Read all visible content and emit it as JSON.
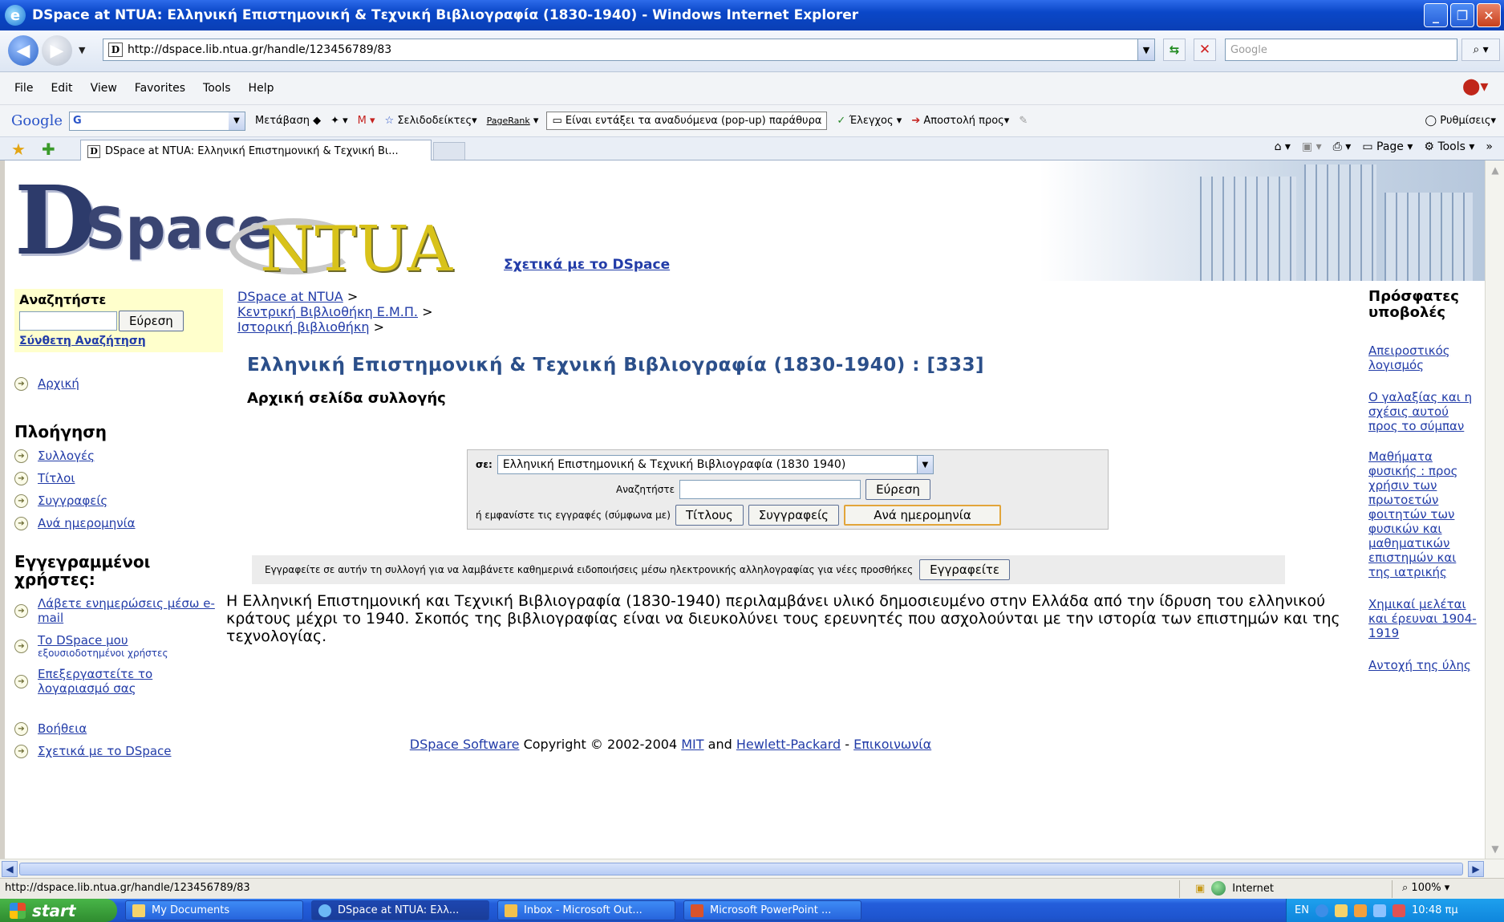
{
  "window": {
    "title": "DSpace at NTUA: Ελληνική Επιστημονική & Τεχνική Βιβλιογραφία (1830-1940) - Windows Internet Explorer",
    "buttons": [
      "_",
      "❐",
      "✕"
    ]
  },
  "address_bar": {
    "url": "http://dspace.lib.ntua.gr/handle/123456789/83",
    "search_placeholder": "Google"
  },
  "menu": [
    "File",
    "Edit",
    "View",
    "Favorites",
    "Tools",
    "Help"
  ],
  "google_toolbar": {
    "logo": "Google",
    "search_value": "G",
    "go": "Μετάβαση",
    "bookmarks": "Σελιδοδείκτες",
    "pagerank": "PageRank",
    "popups": "Είναι εντάξει τα αναδυόμενα (pop-up) παράθυρα",
    "check": "Έλεγχος",
    "send_to": "Αποστολή προς",
    "settings": "Ρυθμίσεις"
  },
  "tabs": {
    "active_title": "DSpace at NTUA: Ελληνική Επιστημονική & Τεχνική Βι...",
    "page": "Page",
    "tools": "Tools"
  },
  "page": {
    "logo": {
      "d": "D",
      "space": "Space",
      "ntua": "NTUA"
    },
    "about_link": "Σχετικά με το DSpace",
    "left": {
      "search_label": "Αναζητήστε",
      "search_button": "Εύρεση",
      "advanced_search": "Σύνθετη Αναζήτηση",
      "home": "Αρχική",
      "browse_heading": "Πλοήγηση",
      "browse_items": [
        "Συλλογές",
        "Τίτλοι",
        "Συγγραφείς",
        "Ανά ημερομηνία"
      ],
      "users_heading": "Εγγεγραμμένοι χρήστες:",
      "user_items": [
        {
          "label": "Λάβετε ενημερώσεις μέσω e-mail",
          "sub": ""
        },
        {
          "label": "Το DSpace μου",
          "sub": "εξουσιοδοτημένοι χρήστες"
        },
        {
          "label": "Επεξεργαστείτε το λογαριασμό σας",
          "sub": ""
        }
      ],
      "help": "Βοήθεια",
      "about": "Σχετικά με το DSpace"
    },
    "breadcrumb": [
      "DSpace at NTUA",
      "Κεντρική Βιβλιοθήκη Ε.Μ.Π.",
      "Ιστορική βιβλιοθήκη"
    ],
    "breadcrumb_sep": ">",
    "collection_title": "Ελληνική Επιστημονική & Τεχνική Βιβλιογραφία (1830-1940) : [333]",
    "collection_subtitle": "Αρχική σελίδα συλλογής",
    "search_panel": {
      "in_label": "σε:",
      "scope": "Ελληνική Επιστημονική & Τεχνική Βιβλιογραφία (1830 1940)",
      "search_label": "Αναζητήστε",
      "find_button": "Εύρεση",
      "browse_label": "ή εμφανίστε τις εγγραφές (σύμφωνα με)",
      "browse_buttons": [
        "Τίτλους",
        "Συγγραφείς",
        "Ανά ημερομηνία"
      ]
    },
    "subscribe": {
      "text": "Εγγραφείτε σε αυτήν τη συλλογή για να λαμβάνετε καθημερινά ειδοποιήσεις μέσω ηλεκτρονικής αλληλογραφίας για νέες προσθήκες",
      "button": "Εγγραφείτε"
    },
    "description": "Η Ελληνική Επιστημονική και Τεχνική Βιβλιογραφία (1830-1940) περιλαμβάνει υλικό δημοσιευμένο στην Ελλάδα από την ίδρυση του ελληνικού κράτους μέχρι το 1940. Σκοπός της βιβλιογραφίας είναι να διευκολύνει τους ερευνητές που ασχολούνται με την ιστορία των επιστημών και της τεχνολογίας.",
    "footer": {
      "software": "DSpace Software",
      "copyright": "Copyright © 2002-2004",
      "mit": "MIT",
      "and": "and",
      "hp": "Hewlett-Packard",
      "dash": "-",
      "contact": "Επικοινωνία"
    },
    "right": {
      "heading": "Πρόσφατες υποβολές",
      "items": [
        "Απειροστικός λογισμός",
        "Ο γαλαξίας και η σχέσις αυτού προς το σύμπαν",
        "Μαθήματα φυσικής : προς χρήσιν των πρωτοετών φοιτητών των φυσικών και μαθηματικών επιστημών και της ιατρικής",
        "Χημικαί μελέται και έρευναι 1904-1919",
        "Αντοχή της ύλης"
      ]
    }
  },
  "status_bar": {
    "url": "http://dspace.lib.ntua.gr/handle/123456789/83",
    "zone": "Internet",
    "zoom": "100%"
  },
  "taskbar": {
    "start": "start",
    "tasks": [
      "My Documents",
      "DSpace at NTUA: Ελλ...",
      "Inbox - Microsoft Out...",
      "Microsoft PowerPoint ..."
    ],
    "lang": "EN",
    "clock": "10:48 πμ"
  },
  "colors": {
    "link": "#223ca8",
    "title_blue": "#2b4f8a",
    "search_highlight": "#ffffcc",
    "titlebar": "#0a47c8"
  }
}
